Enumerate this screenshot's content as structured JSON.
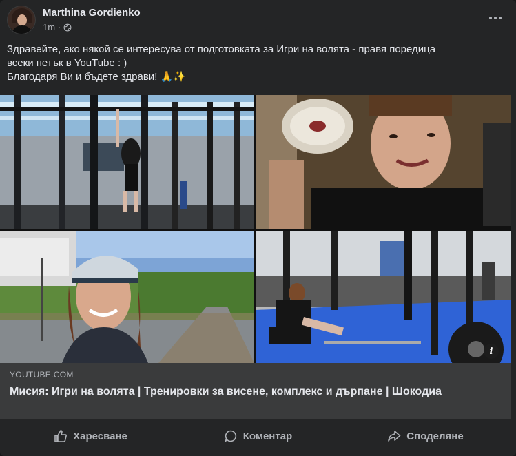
{
  "post": {
    "author": "Marthina Gordienko",
    "time": "1m",
    "separator": "·",
    "privacy_icon": "globe-icon",
    "more_icon": "more-options-icon",
    "text_line1": "Здравейте, ако някой се интересува от подготовката за Игри на волята - правя поредица",
    "text_line2": "всеки петък в YouTube : )",
    "text_line3": "Благодаря Ви и бъдете здрави! 🙏✨"
  },
  "link_preview": {
    "domain": "YOUTUBE.COM",
    "title": "Мисия: Игри на волята | Тренировки за висене, комплекс и дърпане | Шокодиа",
    "info_label": "i",
    "images": [
      "gym-hanging-photo",
      "selfie-with-plate-photo",
      "outdoor-selfie-photo",
      "gym-floor-exercise-photo"
    ]
  },
  "actions": {
    "like": "Харесване",
    "comment": "Коментар",
    "share": "Споделяне",
    "like_icon": "thumbs-up-icon",
    "comment_icon": "comment-icon",
    "share_icon": "share-icon"
  },
  "colors": {
    "background": "#18191a",
    "card": "#242526",
    "link_card": "#3a3b3c",
    "primary_text": "#e4e6eb",
    "secondary_text": "#b0b3b8",
    "gym_floor_blue": "#2f63d6"
  }
}
